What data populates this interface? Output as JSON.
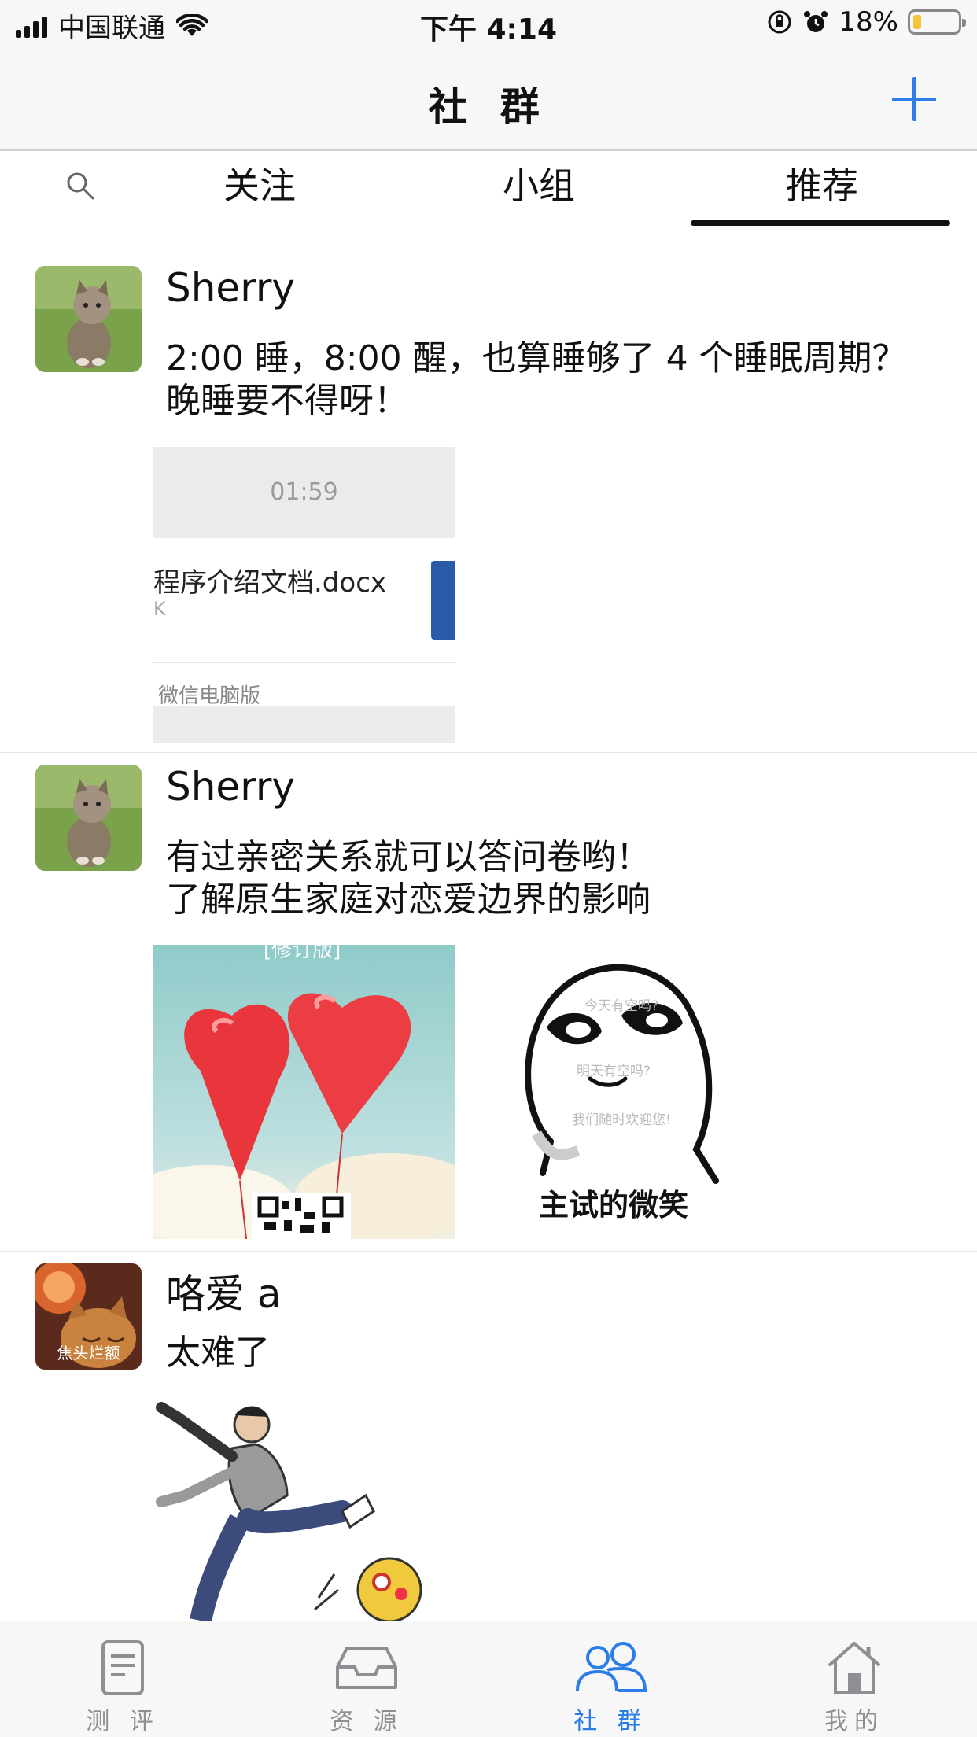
{
  "status_bar": {
    "carrier": "中国联通",
    "time": "下午 4:14",
    "battery": "18%",
    "battery_level": 0.18
  },
  "nav": {
    "title": "社 群"
  },
  "tabs": {
    "items": [
      {
        "label": "关注"
      },
      {
        "label": "小组"
      },
      {
        "label": "推荐"
      }
    ],
    "active_index": 2
  },
  "posts": [
    {
      "author": "Sherry",
      "text": "2:00 睡，8:00 醒，也算睡够了 4 个睡眠周期？\n晚睡要不得呀！",
      "attachment": {
        "duration": "01:59",
        "filename": "程序介绍文档.docx",
        "filesize": "K",
        "source": "微信电脑版"
      }
    },
    {
      "author": "Sherry",
      "text": "有过亲密关系就可以答问卷哟！\n了解原生家庭对恋爱边界的影响",
      "image_top_text": "[修订版]",
      "sticker": {
        "line1": "今天有空吗?",
        "line2": "明天有空吗?",
        "line3": "我们随时欢迎您!",
        "caption": "主试的微笑"
      }
    },
    {
      "author": "咯爱 a",
      "avatar_label": "焦头烂额",
      "text": "太难了"
    }
  ],
  "bottom_tabs": [
    {
      "label": "测 评",
      "icon": "document-icon"
    },
    {
      "label": "资 源",
      "icon": "inbox-icon"
    },
    {
      "label": "社 群",
      "icon": "people-icon"
    },
    {
      "label": "我的",
      "icon": "home-icon"
    }
  ],
  "colors": {
    "accent": "#2b7de9",
    "inactive": "#8e8e93",
    "battery": "#f3c43b"
  }
}
